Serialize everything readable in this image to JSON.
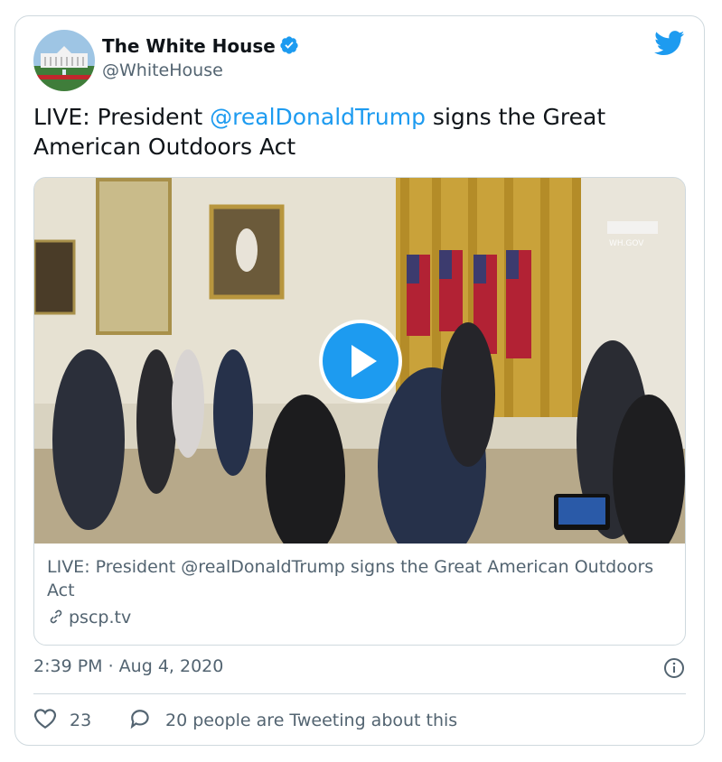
{
  "tweet": {
    "author_name": "The White House",
    "author_handle": "@WhiteHouse",
    "text_before": "LIVE: President ",
    "mention": "@realDonaldTrump",
    "text_after": " signs the Great American Outdoors Act",
    "timestamp": "2:39 PM · Aug 4, 2020",
    "like_count": "23",
    "tweeting_text": "20 people are Tweeting about this"
  },
  "media_card": {
    "title": "LIVE: President @realDonaldTrump signs the Great American Outdoors Act",
    "domain": "pscp.tv",
    "watermark": "WH.GOV"
  },
  "colors": {
    "link_blue": "#1d9bf0",
    "text_primary": "#0f1419",
    "text_secondary": "#536471",
    "border": "#cfd9de"
  },
  "icons": [
    "verified-badge-icon",
    "twitter-bird-icon",
    "play-icon",
    "link-icon",
    "info-icon",
    "heart-icon",
    "chat-bubble-icon"
  ]
}
